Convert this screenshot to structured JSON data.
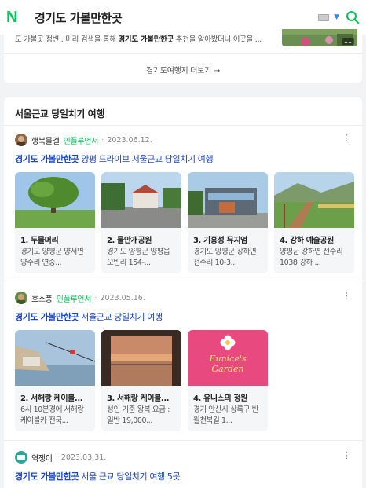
{
  "header": {
    "logo": "N",
    "query": "경기도 가볼만한곳"
  },
  "top_snippet": {
    "pre": "도 가볼곳 정변.. 미리 검색을 통해 ",
    "highlight": "경기도 가볼만한곳",
    "post": " 추천을 알아봤더니 이곳을 ...",
    "thumb_count": "11",
    "more_label": "경기도여행지 더보기 →"
  },
  "section": {
    "title": "서울근교 당일치기 여행"
  },
  "posts": [
    {
      "author": "행복몰결",
      "badge": "인플루언서",
      "date": "2023.06.12.",
      "title_highlight": "경기도 가볼만한곳",
      "title_rest": " 양평 드라이브 서울근교 당일치기 여행",
      "items": [
        {
          "name": "1. 두물머리",
          "desc": "경기도 양평군 양서면 양수리 연중..."
        },
        {
          "name": "2. 물안개공원",
          "desc": "경기도 양평군 양평읍 오빈리 154-..."
        },
        {
          "name": "3. 기흥성 뮤지엄",
          "desc": "경기도 양평군 강하면 전수리 10-3..."
        },
        {
          "name": "4. 강하 예술공원",
          "desc": "양평군 강하면 전수리 1038 강하 ..."
        }
      ]
    },
    {
      "author": "호소풍",
      "badge": "인플루언서",
      "date": "2023.05.16.",
      "title_highlight": "경기도 가볼만한곳",
      "title_rest": " 서울근교 당일치기 여행",
      "items": [
        {
          "name": "2. 서해랑 케이블...",
          "desc": "6시 10분경에 서해랑 케이블카 전국..."
        },
        {
          "name": "3. 서해랑 케이블...",
          "desc": "성인 기준 왕복 요금 : 일반 19,000..."
        },
        {
          "name": "4. 유니스의 정원",
          "desc": "경기 안산시 상록구 반월천북길 1..."
        }
      ],
      "sign_text": "Eunice's Garden"
    },
    {
      "author": "역쟁이",
      "badge": "",
      "date": "2023.03.31.",
      "title_highlight": "경기도 가볼만한곳",
      "title_rest": " 서울 근교 당일치기 여행 5곳"
    }
  ],
  "colors": {
    "brand": "#03c75a",
    "link": "#1a47c9"
  }
}
